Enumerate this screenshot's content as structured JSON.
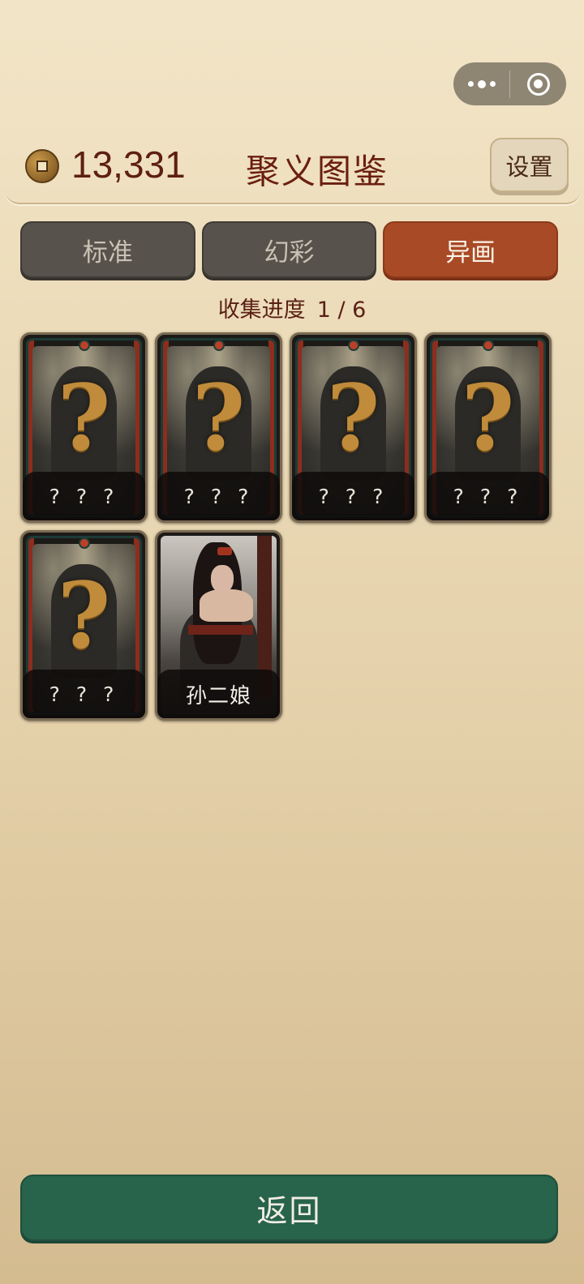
{
  "capsule": {
    "more_icon": "more-dots-icon",
    "close_icon": "target-close-icon"
  },
  "header": {
    "coin_icon": "copper-coin-icon",
    "coins": "13,331",
    "title": "聚义图鉴",
    "settings_label": "设置"
  },
  "tabs": [
    {
      "label": "标准",
      "active": false
    },
    {
      "label": "幻彩",
      "active": false
    },
    {
      "label": "异画",
      "active": true
    }
  ],
  "progress": {
    "label": "收集进度",
    "value": "1 / 6",
    "collected": 1,
    "total": 6
  },
  "cards": [
    {
      "name": "? ? ?",
      "unlocked": false
    },
    {
      "name": "? ? ?",
      "unlocked": false
    },
    {
      "name": "? ? ?",
      "unlocked": false
    },
    {
      "name": "? ? ?",
      "unlocked": false
    },
    {
      "name": "? ? ?",
      "unlocked": false
    },
    {
      "name": "孙二娘",
      "unlocked": true
    }
  ],
  "footer": {
    "back_label": "返回"
  },
  "colors": {
    "active_tab": "#a84a26",
    "inactive_tab": "#57524b",
    "back_button": "#28634c",
    "title_text": "#6b1f10"
  }
}
